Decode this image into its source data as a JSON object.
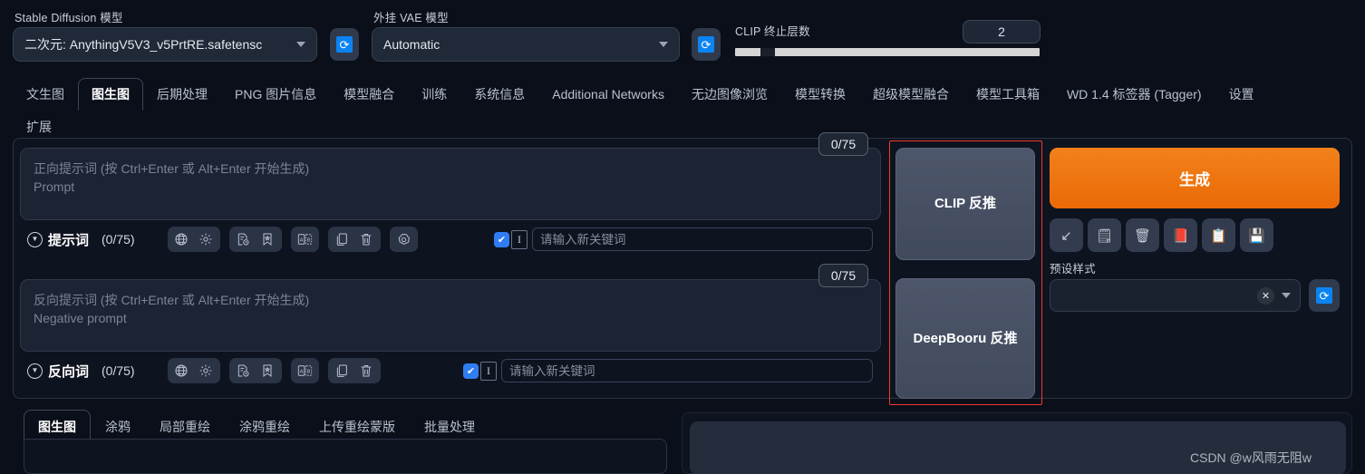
{
  "app": {
    "watermark": "CSDN @w风雨无阻w"
  },
  "topbar": {
    "sd_model_label": "Stable Diffusion 模型",
    "sd_model_value": "二次元: AnythingV5V3_v5PrtRE.safetensc",
    "vae_label": "外挂 VAE 模型",
    "vae_value": "Automatic",
    "clip_label": "CLIP 终止层数",
    "clip_value": "2",
    "refresh_icon": "refresh-icon"
  },
  "main_tabs": [
    {
      "label": "文生图",
      "active": false
    },
    {
      "label": "图生图",
      "active": true
    },
    {
      "label": "后期处理",
      "active": false
    },
    {
      "label": "PNG 图片信息",
      "active": false
    },
    {
      "label": "模型融合",
      "active": false
    },
    {
      "label": "训练",
      "active": false
    },
    {
      "label": "系统信息",
      "active": false
    },
    {
      "label": "Additional Networks",
      "active": false
    },
    {
      "label": "无边图像浏览",
      "active": false
    },
    {
      "label": "模型转换",
      "active": false
    },
    {
      "label": "超级模型融合",
      "active": false
    },
    {
      "label": "模型工具箱",
      "active": false
    },
    {
      "label": "WD 1.4 标签器 (Tagger)",
      "active": false
    },
    {
      "label": "设置",
      "active": false
    },
    {
      "label": "扩展",
      "active": false
    }
  ],
  "positive": {
    "placeholder_line1": "正向提示词 (按 Ctrl+Enter 或 Alt+Enter 开始生成)",
    "placeholder_line2": "Prompt",
    "token_badge": "0/75",
    "section_title": "提示词",
    "section_count": "(0/75)",
    "keyword_placeholder": "请输入新关键词",
    "keyword_value": "",
    "icons": [
      "globe-icon",
      "gear-icon",
      "history-icon",
      "bookmark-star-icon",
      "translate-ab-icon",
      "copy-icon",
      "trash-icon",
      "openai-spiral-icon"
    ]
  },
  "negative": {
    "placeholder_line1": "反向提示词 (按 Ctrl+Enter 或 Alt+Enter 开始生成)",
    "placeholder_line2": "Negative prompt",
    "token_badge": "0/75",
    "section_title": "反向词",
    "section_count": "(0/75)",
    "keyword_placeholder": "请输入新关键词",
    "keyword_value": "",
    "icons": [
      "globe-icon",
      "gear-icon",
      "history-icon",
      "bookmark-star-icon",
      "translate-ab-icon",
      "copy-icon",
      "trash-icon"
    ]
  },
  "interrogate": {
    "clip_label": "CLIP 反推",
    "deepbooru_label": "DeepBooru 反推",
    "highlight_color": "#f0392b"
  },
  "actions": {
    "generate_label": "生成",
    "generate_color": "#ea6a07",
    "tool_icons": [
      {
        "name": "arrow-down-left-icon",
        "glyph": "↙"
      },
      {
        "name": "paste-icon",
        "glyph": "🗒"
      },
      {
        "name": "trash-icon",
        "glyph": "🗑"
      },
      {
        "name": "book-icon",
        "glyph": "📕"
      },
      {
        "name": "clipboard-icon",
        "glyph": "📋"
      },
      {
        "name": "save-icon",
        "glyph": "💾"
      }
    ],
    "styles_label": "预设样式",
    "styles_value": "",
    "styles_clear_icon": "clear-x-icon",
    "styles_refresh_icon": "refresh-icon"
  },
  "sub_tabs": [
    {
      "label": "图生图",
      "active": true
    },
    {
      "label": "涂鸦",
      "active": false
    },
    {
      "label": "局部重绘",
      "active": false
    },
    {
      "label": "涂鸦重绘",
      "active": false
    },
    {
      "label": "上传重绘蒙版",
      "active": false
    },
    {
      "label": "批量处理",
      "active": false
    }
  ]
}
